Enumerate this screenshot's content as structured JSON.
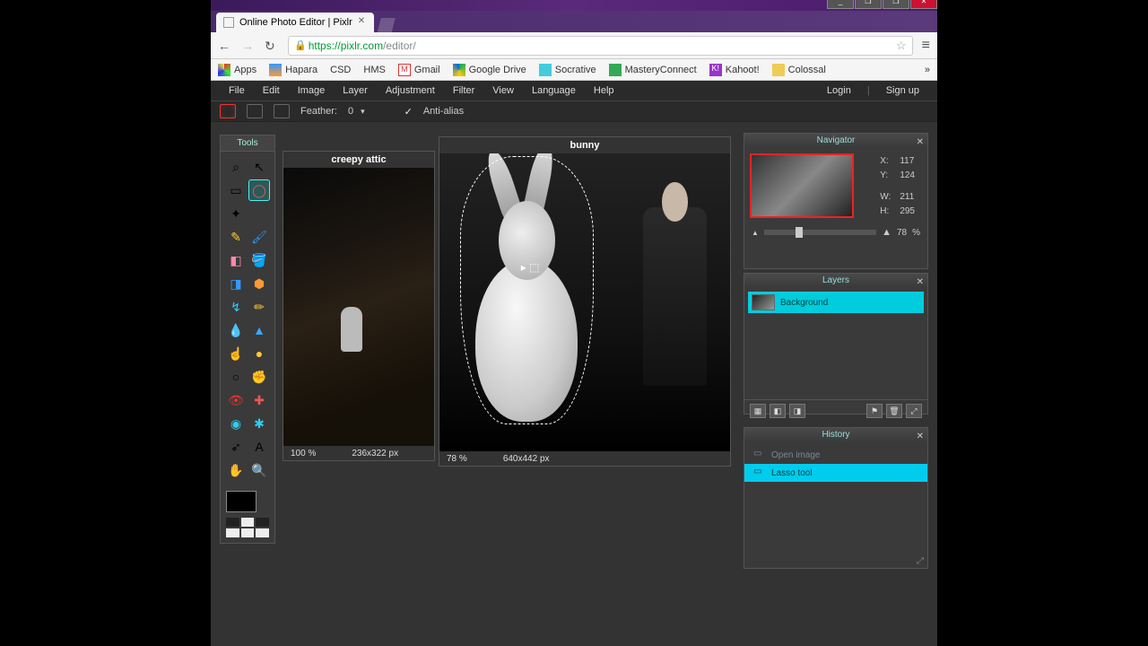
{
  "window": {
    "min": "_",
    "max": "❐",
    "restore": "❐",
    "close": "✕"
  },
  "tab": {
    "title": "Online Photo Editor | Pixlr",
    "close": "✕"
  },
  "nav": {
    "back": "←",
    "fwd": "→",
    "reload": "↻"
  },
  "url": {
    "scheme": "https://",
    "host": "pixlr.com",
    "path": "/editor/",
    "star": "☆",
    "menu": "≡"
  },
  "bookmarks": {
    "apps": "Apps",
    "items": [
      "Hapara",
      "CSD",
      "HMS",
      "Gmail",
      "Google Drive",
      "Socrative",
      "MasteryConnect",
      "Kahoot!",
      "Colossal"
    ],
    "more": "»"
  },
  "menu": {
    "items": [
      "File",
      "Edit",
      "Image",
      "Layer",
      "Adjustment",
      "Filter",
      "View",
      "Language",
      "Help"
    ],
    "login": "Login",
    "divider": "|",
    "signup": "Sign up"
  },
  "options": {
    "feather_label": "Feather:",
    "feather_value": "0",
    "antialias": "Anti-alias",
    "check": "✓",
    "dd": "▾"
  },
  "tools": {
    "title": "Tools",
    "items": [
      {
        "name": "crop",
        "g": "⌕"
      },
      {
        "name": "move",
        "g": "↖"
      },
      {
        "name": "marquee",
        "g": "▭"
      },
      {
        "name": "lasso",
        "g": "◯",
        "active": true
      },
      {
        "name": "wand",
        "g": "✦"
      },
      {
        "name": "",
        "g": ""
      },
      {
        "name": "pencil",
        "g": "✎"
      },
      {
        "name": "brush",
        "g": "🖌"
      },
      {
        "name": "eraser",
        "g": "◧"
      },
      {
        "name": "bucket",
        "g": "🪣"
      },
      {
        "name": "gradient",
        "g": "◨"
      },
      {
        "name": "clone",
        "g": "⬢"
      },
      {
        "name": "replace",
        "g": "↯"
      },
      {
        "name": "draw",
        "g": "✏"
      },
      {
        "name": "blur",
        "g": "💧"
      },
      {
        "name": "sharpen",
        "g": "▲"
      },
      {
        "name": "smudge",
        "g": "☝"
      },
      {
        "name": "sponge",
        "g": "●"
      },
      {
        "name": "dodge",
        "g": "○"
      },
      {
        "name": "burn",
        "g": "✊"
      },
      {
        "name": "redeye",
        "g": "👁"
      },
      {
        "name": "spot",
        "g": "✚"
      },
      {
        "name": "bloat",
        "g": "◉"
      },
      {
        "name": "pinch",
        "g": "✱"
      },
      {
        "name": "picker",
        "g": "➶"
      },
      {
        "name": "type",
        "g": "A"
      },
      {
        "name": "hand",
        "g": "✋"
      },
      {
        "name": "zoom",
        "g": "🔍"
      }
    ]
  },
  "docs": {
    "a": {
      "title": "creepy attic",
      "zoom": "100",
      "pct": "%",
      "dims": "236x322 px"
    },
    "b": {
      "title": "bunny",
      "zoom": "78",
      "pct": "%",
      "dims": "640x442 px"
    }
  },
  "navigator": {
    "title": "Navigator",
    "close": "✕",
    "x_lbl": "X:",
    "x": "117",
    "y_lbl": "Y:",
    "y": "124",
    "w_lbl": "W:",
    "w": "211",
    "h_lbl": "H:",
    "h": "295",
    "zoom": "78",
    "pct": "%",
    "zout": "▲",
    "zin": "▲"
  },
  "layers": {
    "title": "Layers",
    "close": "✕",
    "bg": "Background",
    "btns": [
      "▦",
      "◧",
      "◨",
      "",
      "⚑",
      "🗑",
      "⤢"
    ]
  },
  "history": {
    "title": "History",
    "close": "✕",
    "items": [
      {
        "label": "Open image",
        "active": false
      },
      {
        "label": "Lasso tool",
        "active": true
      }
    ],
    "resize": "⤢"
  }
}
